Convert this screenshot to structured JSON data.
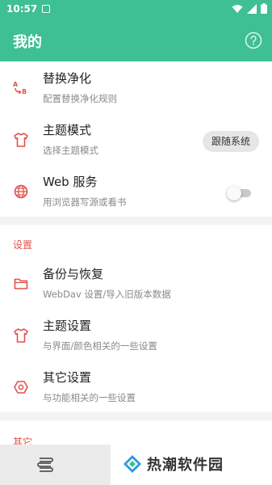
{
  "status": {
    "time": "10:57"
  },
  "app": {
    "title": "我的"
  },
  "colors": {
    "accent": "#3fbf94",
    "icon_red": "#e0524a"
  },
  "main_items": [
    {
      "title": "替换净化",
      "subtitle": "配置替换净化规则",
      "icon": "replace-icon"
    },
    {
      "title": "主题模式",
      "subtitle": "选择主题模式",
      "icon": "shirt-icon",
      "value": "跟随系统"
    },
    {
      "title": "Web 服务",
      "subtitle": "用浏览器写源或看书",
      "icon": "globe-icon",
      "toggle": false
    }
  ],
  "settings": {
    "header": "设置",
    "items": [
      {
        "title": "备份与恢复",
        "subtitle": "WebDav 设置/导入旧版本数据",
        "icon": "folder-icon"
      },
      {
        "title": "主题设置",
        "subtitle": "与界面/颜色相关的一些设置",
        "icon": "shirt-icon"
      },
      {
        "title": "其它设置",
        "subtitle": "与功能相关的一些设置",
        "icon": "hexagon-settings-icon"
      }
    ]
  },
  "other": {
    "header": "其它"
  },
  "watermark": {
    "text": "热潮软件园"
  }
}
